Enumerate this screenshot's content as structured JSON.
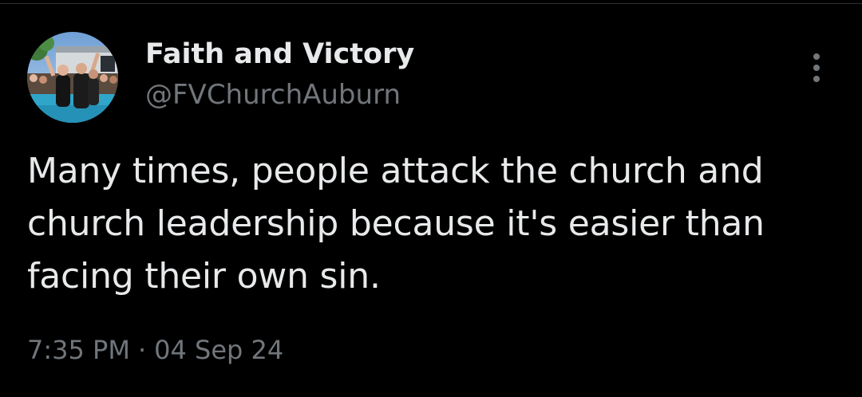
{
  "tweet": {
    "author_name": "Faith and Victory",
    "author_handle": "@FVChurchAuburn",
    "text": "Many times, people attack the church and church leadership because it's easier than facing their own sin.",
    "time": "7:35 PM",
    "separator": "·",
    "date": "04 Sep 24"
  },
  "icons": {
    "more": "more-vertical-icon"
  },
  "colors": {
    "background": "#000000",
    "primary_text": "#e7e9ea",
    "secondary_text": "#71767b",
    "divider": "#2f3336"
  }
}
